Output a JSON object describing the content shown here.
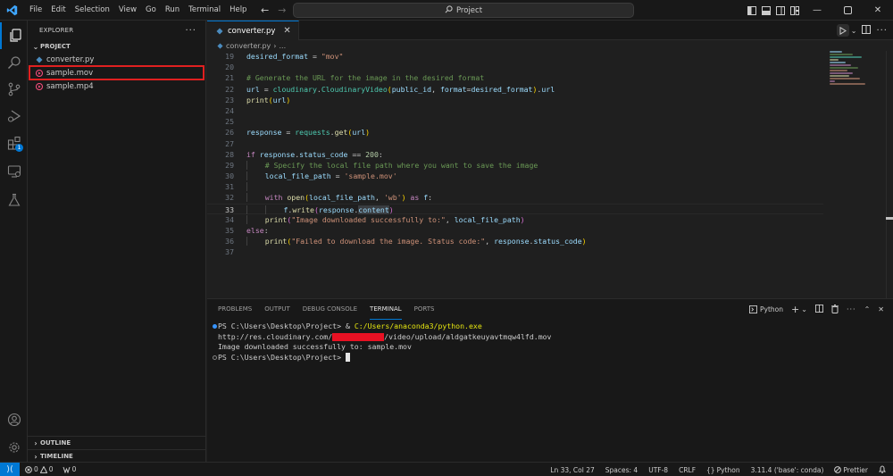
{
  "titlebar": {
    "menu": [
      "File",
      "Edit",
      "Selection",
      "View",
      "Go",
      "Run",
      "Terminal",
      "Help"
    ],
    "search_text": "Project"
  },
  "activity": {
    "extensions_badge": "1"
  },
  "sidebar": {
    "header": "EXPLORER",
    "section": "PROJECT",
    "files": [
      {
        "name": "converter.py",
        "type": "python"
      },
      {
        "name": "sample.mov",
        "type": "video"
      },
      {
        "name": "sample.mp4",
        "type": "video"
      }
    ],
    "outline": "OUTLINE",
    "timeline": "TIMELINE"
  },
  "editor": {
    "tab": "converter.py",
    "breadcrumb_file": "converter.py",
    "breadcrumb_rest": "...",
    "current_line": 33,
    "line_numbers": [
      "19",
      "20",
      "21",
      "22",
      "23",
      "24",
      "25",
      "26",
      "27",
      "28",
      "29",
      "30",
      "31",
      "32",
      "33",
      "34",
      "35",
      "36",
      "37"
    ],
    "code": {
      "l19a": "desired_format",
      "l19b": " = ",
      "l19c": "\"mov\"",
      "l21": "# Generate the URL for the image in the desired format",
      "l22a": "url",
      "l22b": " = ",
      "l22c": "cloudinary",
      "l22d": ".",
      "l22e": "CloudinaryVideo",
      "l22f": "(",
      "l22g": "public_id",
      "l22h": ", ",
      "l22i": "format",
      "l22j": "=",
      "l22k": "desired_format",
      "l22l": ")",
      "l22m": ".",
      "l22n": "url",
      "l23a": "print",
      "l23b": "(",
      "l23c": "url",
      "l23d": ")",
      "l26a": "response",
      "l26b": " = ",
      "l26c": "requests",
      "l26d": ".",
      "l26e": "get",
      "l26f": "(",
      "l26g": "url",
      "l26h": ")",
      "l28a": "if",
      "l28b": " response",
      "l28c": ".",
      "l28d": "status_code",
      "l28e": " == ",
      "l28f": "200",
      "l28g": ":",
      "l29": "# Specify the local file path where you want to save the image",
      "l30a": "local_file_path",
      "l30b": " = ",
      "l30c": "'sample.mov'",
      "l32a": "with",
      "l32b": " ",
      "l32c": "open",
      "l32d": "(",
      "l32e": "local_file_path",
      "l32f": ", ",
      "l32g": "'wb'",
      "l32h": ")",
      "l32i": " as ",
      "l32j": "f",
      "l32k": ":",
      "l33a": "f",
      "l33b": ".",
      "l33c": "write",
      "l33d": "(",
      "l33e": "response",
      "l33f": ".",
      "l33g": "content",
      "l33h": ")",
      "l34a": "print",
      "l34b": "(",
      "l34c": "\"Image downloaded successfully to:\"",
      "l34d": ", ",
      "l34e": "local_file_path",
      "l34f": ")",
      "l35a": "else",
      "l35b": ":",
      "l36a": "print",
      "l36b": "(",
      "l36c": "\"Failed to download the image. Status code:\"",
      "l36d": ", ",
      "l36e": "response",
      "l36f": ".",
      "l36g": "status_code",
      "l36h": ")"
    }
  },
  "panel": {
    "tabs": [
      "PROBLEMS",
      "OUTPUT",
      "DEBUG CONSOLE",
      "TERMINAL",
      "PORTS"
    ],
    "active_tab": "TERMINAL",
    "terminal_profile": "Python",
    "terminal": {
      "line1_prompt": "PS C:\\Users\\Desktop\\Project> ",
      "line1_cmd_a": "& ",
      "line1_cmd_b": "C:/Users/anaconda3/python.exe",
      "line2_a": "http://res.cloudinary.com/",
      "line2_b": "/video/upload/aldgatkeuyavtmqw4lfd.mov",
      "line3": "Image downloaded successfully to: sample.mov",
      "line4_prompt": "PS C:\\Users\\Desktop\\Project> "
    }
  },
  "statusbar": {
    "errors": "0",
    "warnings": "0",
    "ports": "0",
    "position": "Ln 33, Col 27",
    "spaces": "Spaces: 4",
    "encoding": "UTF-8",
    "eol": "CRLF",
    "language": "Python",
    "interpreter": "3.11.4 ('base': conda)",
    "prettier": "Prettier"
  },
  "colors": {
    "accent": "#0078d4",
    "highlight_box": "#e02020",
    "redaction": "#e81123"
  }
}
